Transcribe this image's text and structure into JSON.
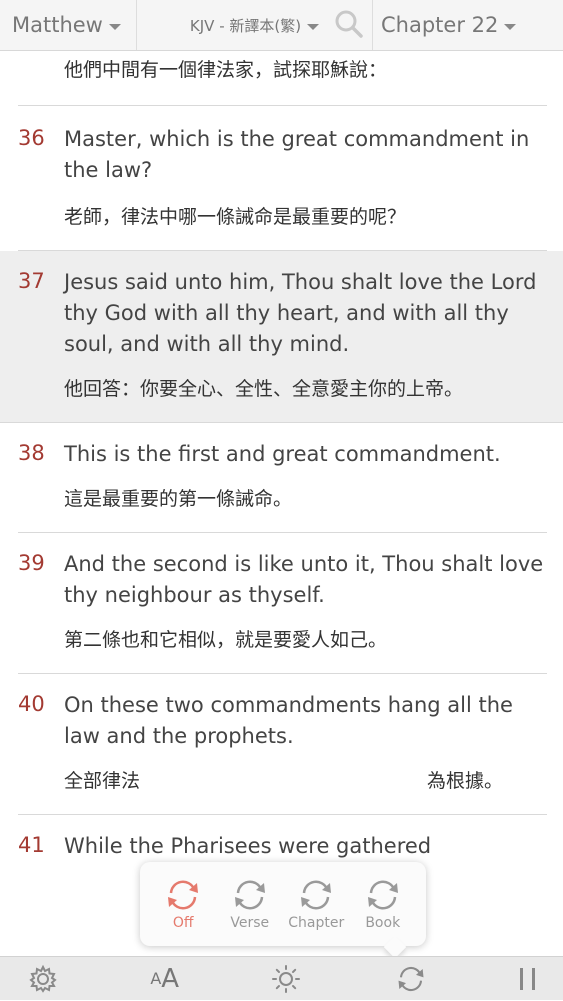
{
  "header": {
    "book": "Matthew",
    "version": "KJV - 新譯本(繁)",
    "chapter": "Chapter 22"
  },
  "top_fragment": "他們中間有一個律法家，試探耶穌說：",
  "verses": [
    {
      "num": "36",
      "en": "Master, which is the great commandment in the law?",
      "zh": "老師，律法中哪一條誡命是最重要的呢？",
      "highlighted": false
    },
    {
      "num": "37",
      "en": "Jesus said unto him, Thou shalt love the Lord thy God with all thy heart, and with all thy soul, and with all thy mind.",
      "zh": "他回答：你要全心、全性、全意愛主你的上帝。",
      "highlighted": true
    },
    {
      "num": "38",
      "en": "This is the first and great commandment.",
      "zh": "這是最重要的第一條誡命。",
      "highlighted": false
    },
    {
      "num": "39",
      "en": "And the second is like unto it, Thou shalt love thy neighbour as thyself.",
      "zh": "第二條也和它相似，就是要愛人如己。",
      "highlighted": false
    },
    {
      "num": "40",
      "en": "On these two commandments hang all the law and the prophets.",
      "zh_left": "全部律法",
      "zh_right": "為根據。",
      "highlighted": false
    },
    {
      "num": "41",
      "en": "While the Pharisees were gathered"
    }
  ],
  "popup": {
    "options": [
      "Off",
      "Verse",
      "Chapter",
      "Book"
    ],
    "active": "Off"
  },
  "toolbar": {
    "font_small": "A",
    "font_big": "A"
  },
  "colors": {
    "verse_number": "#a33a32",
    "highlight_bg": "#eeeeee",
    "popup_active": "#e57a6d"
  }
}
